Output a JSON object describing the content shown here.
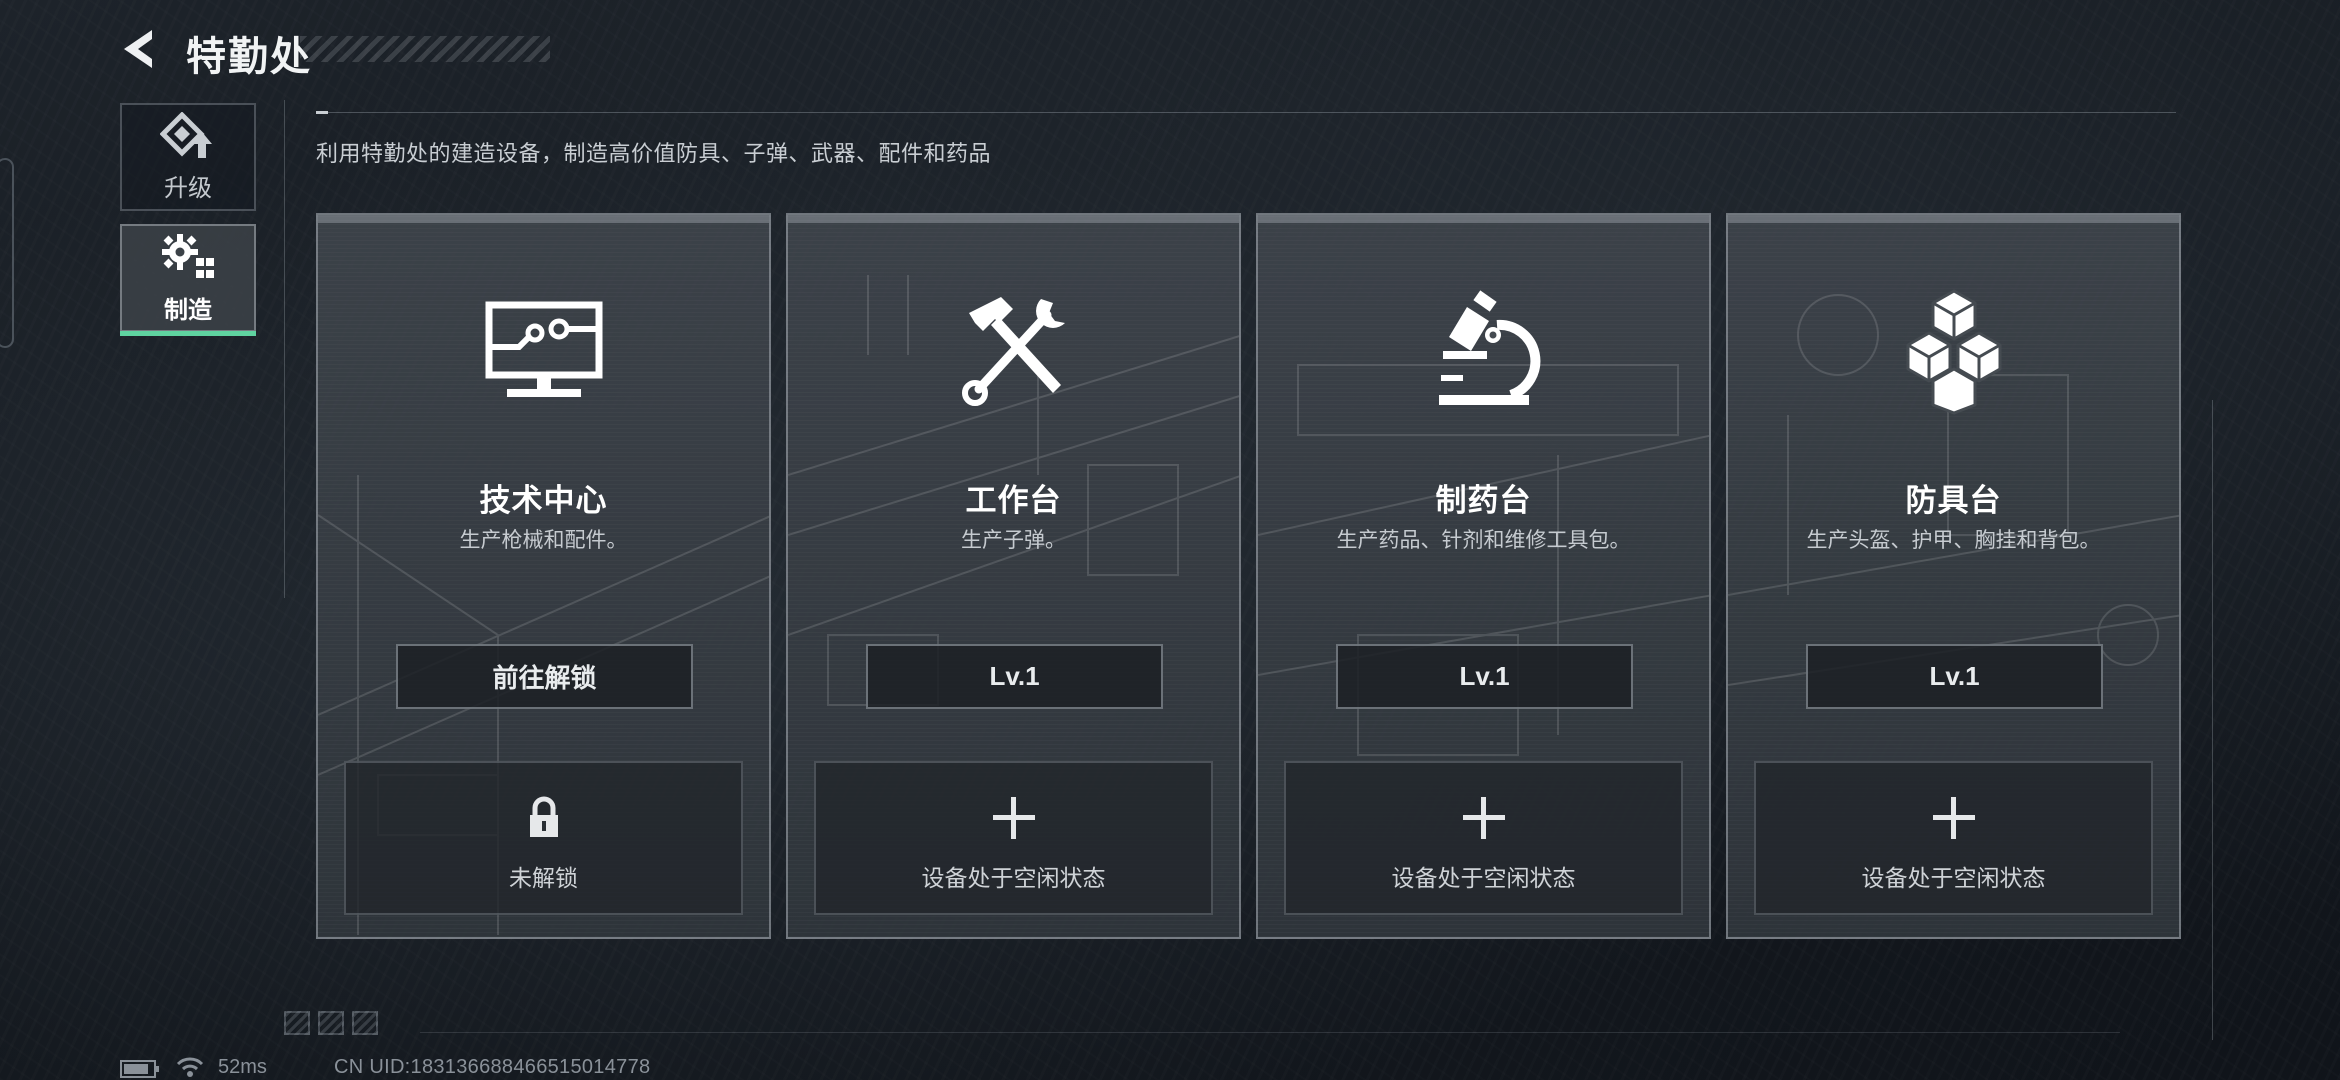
{
  "header": {
    "title": "特勤处",
    "back_icon": "back-chevron-icon"
  },
  "sidebar": {
    "items": [
      {
        "label": "升级",
        "icon": "upgrade-icon",
        "active": false
      },
      {
        "label": "制造",
        "icon": "gears-crafting-icon",
        "active": true
      }
    ]
  },
  "subtitle": "利用特勤处的建造设备，制造高价值防具、子弹、武器、配件和药品",
  "cards": [
    {
      "name": "技术中心",
      "desc": "生产枪械和配件。",
      "icon": "monitor-circuit-icon",
      "button": "前往解锁",
      "slot_icon": "padlock-icon",
      "slot_text": "未解锁"
    },
    {
      "name": "工作台",
      "desc": "生产子弹。",
      "icon": "hammer-wrench-icon",
      "button": "Lv.1",
      "slot_icon": "plus-icon",
      "slot_text": "设备处于空闲状态"
    },
    {
      "name": "制药台",
      "desc": "生产药品、针剂和维修工具包。",
      "icon": "microscope-icon",
      "button": "Lv.1",
      "slot_icon": "plus-icon",
      "slot_text": "设备处于空闲状态"
    },
    {
      "name": "防具台",
      "desc": "生产头盔、护甲、胸挂和背包。",
      "icon": "stacked-cubes-icon",
      "button": "Lv.1",
      "slot_icon": "plus-icon",
      "slot_text": "设备处于空闲状态"
    }
  ],
  "status_bar": {
    "ping": "52ms",
    "uid": "CN UID:18313668846651501477​8"
  },
  "colors": {
    "accent": "#5fd3a0",
    "card_bg": "#3e444b",
    "background": "#151a20"
  }
}
